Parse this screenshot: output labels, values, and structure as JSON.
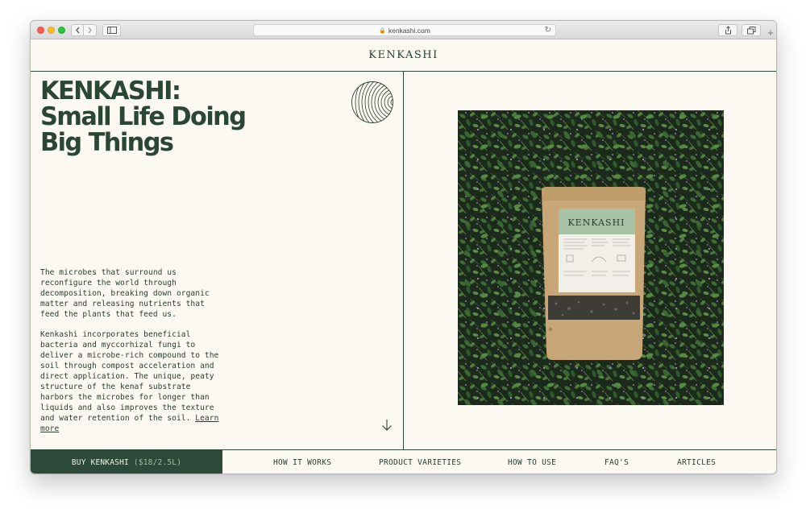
{
  "browser": {
    "url": "kenkashi.com",
    "icons": {
      "back": "chevron-left-icon",
      "forward": "chevron-right-icon",
      "sidebar": "sidebar-icon",
      "lock": "lock-icon",
      "reload": "reload-icon",
      "share": "share-icon",
      "tabs": "tabs-icon",
      "new_tab": "plus-icon"
    }
  },
  "header": {
    "logo": "KENKASHI"
  },
  "hero": {
    "title_line1": "KENKASHI:",
    "title_line2": "Small Life Doing",
    "title_line3": "Big Things",
    "emblem_icon": "ring-emblem-icon",
    "paragraph1": "The microbes that surround us reconfigure the world through decomposition, breaking down organic matter and releasing nutrients that feed the plants that feed us.",
    "paragraph2": "Kenkashi incorporates beneficial bacteria and myccorhizal fungi to deliver a microbe-rich compound to the soil through compost acceleration and direct application. The unique, peaty structure of the kenaf substrate harbors the microbes for longer than liquids and also improves the texture and water retention of the soil.",
    "learn_more": "Learn more",
    "scroll_icon": "arrow-down-icon"
  },
  "product": {
    "bag_label": "KENKASHI"
  },
  "bottom_nav": {
    "buy_label": "BUY KENKASHI",
    "buy_price": "($18/2.5L)",
    "items": [
      "HOW IT WORKS",
      "PRODUCT VARIETIES",
      "HOW TO USE",
      "FAQ'S",
      "ARTICLES"
    ]
  },
  "colors": {
    "background": "#fbf9f1",
    "brand_green": "#2c4a39",
    "text": "#2c3d33"
  }
}
